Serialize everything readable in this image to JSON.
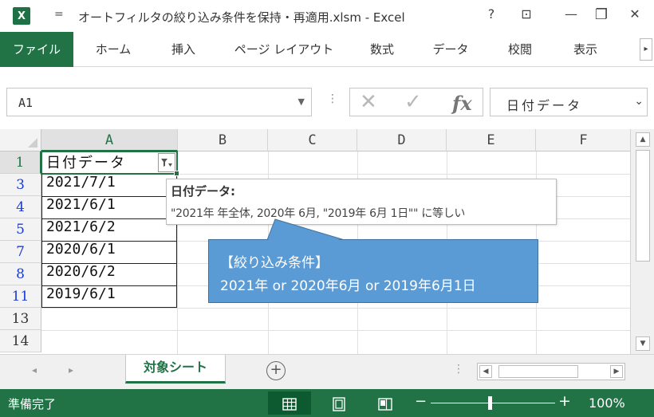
{
  "app": {
    "logo_text": "X",
    "qat_icon": "customize-qat-icon",
    "title": "オートフィルタの絞り込み条件を保持・再適用.xlsm - Excel",
    "help": "?",
    "ribbon_display": "⊡",
    "minimize": "—",
    "close": "✕"
  },
  "ribbon": {
    "tabs": [
      "ファイル",
      "ホーム",
      "挿入",
      "ページ レイアウト",
      "数式",
      "データ",
      "校閲",
      "表示"
    ],
    "scroll": "▸"
  },
  "formula_bar": {
    "name_box": "A1",
    "dots": "⋮",
    "cancel": "✕",
    "enter": "✓",
    "fx": "fx",
    "value": "日付データ",
    "dropdown": "⌄"
  },
  "grid": {
    "columns": [
      "A",
      "B",
      "C",
      "D",
      "E",
      "F"
    ],
    "rows": [
      {
        "num": "1",
        "value": "日付データ",
        "filtered": false
      },
      {
        "num": "3",
        "value": "2021/7/1",
        "filtered": true
      },
      {
        "num": "4",
        "value": "2021/6/1",
        "filtered": true
      },
      {
        "num": "5",
        "value": "2021/6/2",
        "filtered": true
      },
      {
        "num": "7",
        "value": "2020/6/1",
        "filtered": true
      },
      {
        "num": "8",
        "value": "2020/6/2",
        "filtered": true
      },
      {
        "num": "11",
        "value": "2019/6/1",
        "filtered": true
      },
      {
        "num": "13",
        "value": "",
        "filtered": false
      },
      {
        "num": "14",
        "value": "",
        "filtered": false
      }
    ]
  },
  "tooltip": {
    "title": "日付データ:",
    "body": "\"2021年 年全体, 2020年 6月, \"2019年 6月 1日\"\" に等しい"
  },
  "callout": {
    "line1": "【絞り込み条件】",
    "line2": "2021年 or 2020年6月 or 2019年6月1日",
    "color": "#5b9bd5"
  },
  "sheets": {
    "active": "対象シート",
    "add": "+"
  },
  "status": {
    "text": "準備完了",
    "zoom": "100%",
    "zoom_minus": "−",
    "zoom_plus": "+"
  },
  "colors": {
    "excel_green": "#217346",
    "filtered_row_number": "#1a3bd6"
  }
}
